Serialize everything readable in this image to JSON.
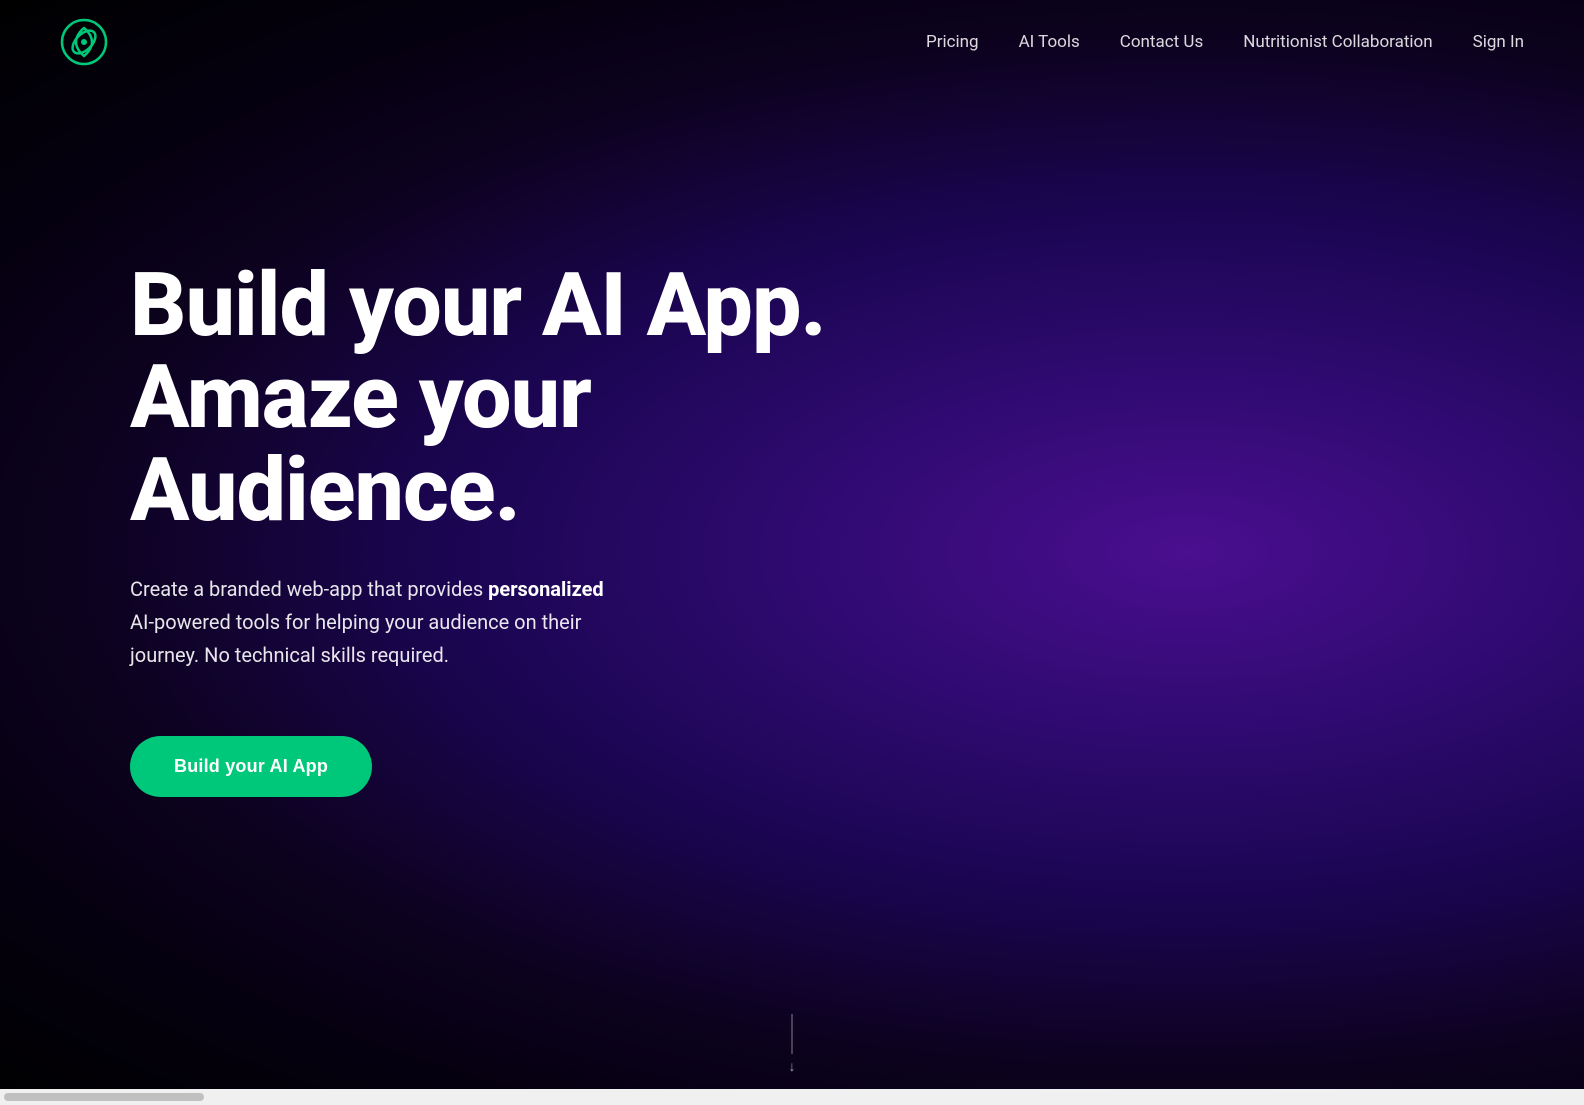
{
  "nav": {
    "logo_alt": "Logo",
    "links": [
      {
        "label": "Pricing",
        "id": "pricing"
      },
      {
        "label": "AI Tools",
        "id": "ai-tools"
      },
      {
        "label": "Contact Us",
        "id": "contact"
      },
      {
        "label": "Nutritionist Collaboration",
        "id": "nutritionist"
      },
      {
        "label": "Sign In",
        "id": "signin"
      }
    ]
  },
  "hero": {
    "title_line1": "Build your AI App.",
    "title_line2": "Amaze your Audience.",
    "subtitle_part1": "Create a branded web-app that provides ",
    "subtitle_bold": "personalized",
    "subtitle_part2": " AI-powered tools for helping your audience on their journey. No technical skills required.",
    "cta_label": "Build your AI App"
  },
  "scroll": {
    "indicator": "↓"
  },
  "colors": {
    "cta_bg": "#00c87a",
    "bg_gradient_start": "#4a0e8f",
    "bg_gradient_end": "#000000"
  }
}
